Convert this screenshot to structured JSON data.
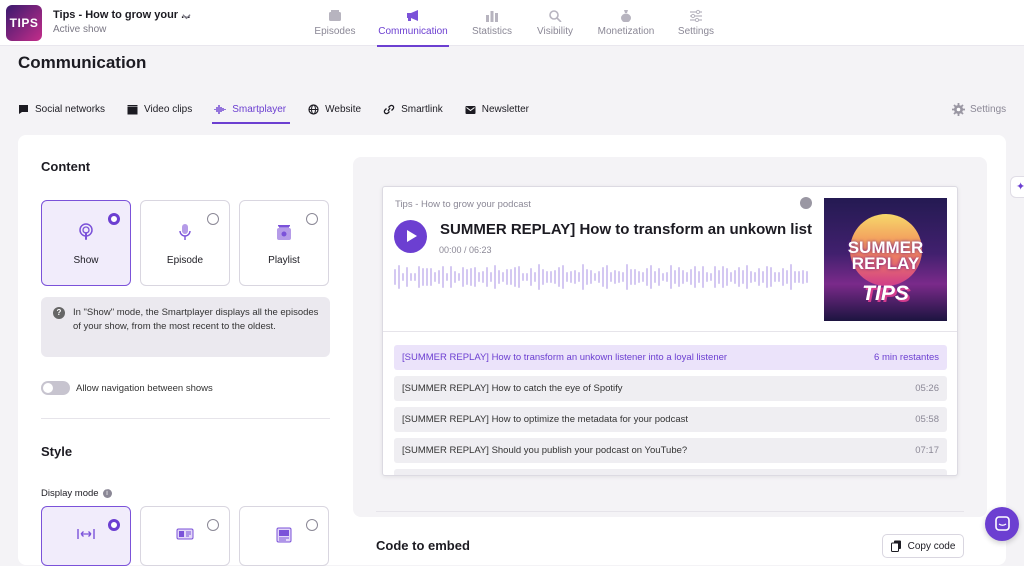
{
  "header": {
    "logo_text": "TIPS",
    "show_title": "Tips - How to grow your ...",
    "show_subtitle": "Active show",
    "nav": [
      {
        "label": "Episodes",
        "icon": "episodes-icon",
        "active": false
      },
      {
        "label": "Communication",
        "icon": "megaphone-icon",
        "active": true
      },
      {
        "label": "Statistics",
        "icon": "bar-chart-icon",
        "active": false
      },
      {
        "label": "Visibility",
        "icon": "magnifier-icon",
        "active": false
      },
      {
        "label": "Monetization",
        "icon": "money-bag-icon",
        "active": false
      },
      {
        "label": "Settings",
        "icon": "sliders-icon",
        "active": false
      }
    ]
  },
  "page": {
    "title": "Communication",
    "settings_label": "Settings",
    "tabs": [
      {
        "label": "Social networks",
        "icon": "chat-bubble-icon"
      },
      {
        "label": "Video clips",
        "icon": "clapperboard-icon"
      },
      {
        "label": "Smartplayer",
        "icon": "waveform-icon",
        "active": true
      },
      {
        "label": "Website",
        "icon": "globe-icon"
      },
      {
        "label": "Smartlink",
        "icon": "link-icon"
      },
      {
        "label": "Newsletter",
        "icon": "mail-icon"
      }
    ]
  },
  "content": {
    "title": "Content",
    "options": [
      {
        "label": "Show",
        "selected": true
      },
      {
        "label": "Episode",
        "selected": false
      },
      {
        "label": "Playlist",
        "selected": false
      }
    ],
    "info_text": "In \"Show\" mode, the Smartplayer displays all the episodes of your show, from the most recent to the oldest.",
    "toggle_label": "Allow navigation between shows",
    "toggle_on": false
  },
  "style": {
    "title": "Style",
    "display_mode_label": "Display mode"
  },
  "player": {
    "show_name": "Tips - How to grow your podcast",
    "episode_title": "[SUMMER REPLAY] How to transform an unkown listener into a loyal listener",
    "time": "00:00 / 06:23",
    "cover_line1": "SUMMER",
    "cover_line2": "REPLAY",
    "cover_line3": "TIPS",
    "episodes": [
      {
        "title": "[SUMMER REPLAY] How to transform an unkown listener into a loyal listener",
        "duration": "6 min restantes",
        "active": true
      },
      {
        "title": "[SUMMER REPLAY] How to catch the eye of Spotify",
        "duration": "05:26",
        "active": false
      },
      {
        "title": "[SUMMER REPLAY] How to optimize the metadata for your podcast",
        "duration": "05:58",
        "active": false
      },
      {
        "title": "[SUMMER REPLAY] Should you publish your podcast on YouTube?",
        "duration": "07:17",
        "active": false
      }
    ]
  },
  "embed": {
    "title": "Code to embed",
    "copy_label": "Copy code"
  },
  "colors": {
    "accent": "#6c3fd1",
    "accent_light": "#f1ecfb"
  }
}
